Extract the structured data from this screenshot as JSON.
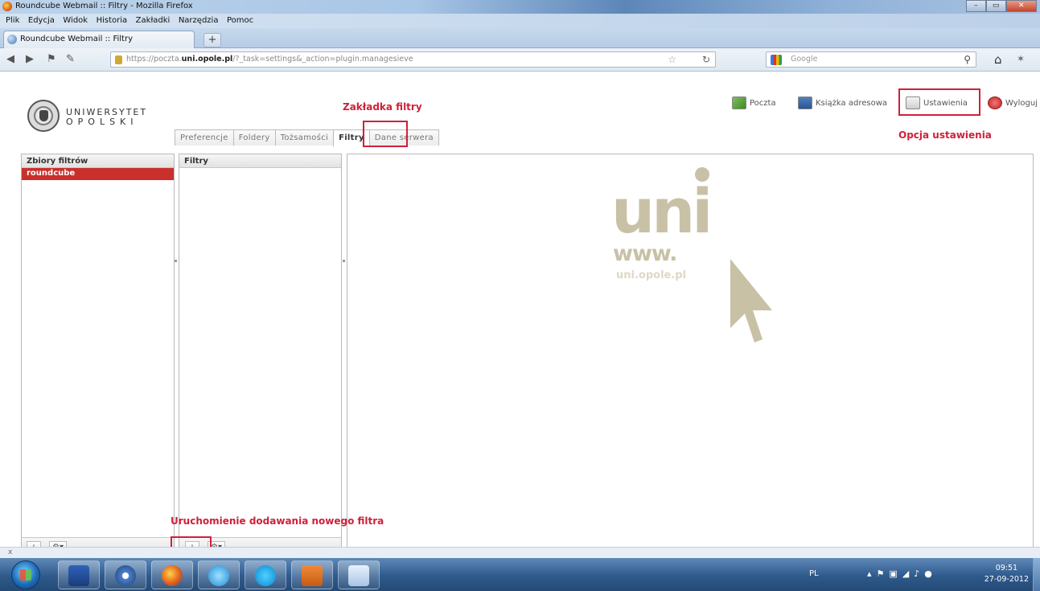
{
  "window": {
    "title": "Roundcube Webmail :: Filtry - Mozilla Firefox",
    "minimize": "–",
    "maximize": "▭",
    "close": "✕"
  },
  "menubar": [
    "Plik",
    "Edycja",
    "Widok",
    "Historia",
    "Zakładki",
    "Narzędzia",
    "Pomoc"
  ],
  "browser_tab": {
    "label": "Roundcube Webmail :: Filtry",
    "newtab": "+"
  },
  "navbar": {
    "url_prefix": "https://poczta.",
    "url_host": "uni.opole.pl",
    "url_path": "/?_task=settings&_action=plugin.managesieve",
    "search_engine": "Google"
  },
  "logo": {
    "line1": "UNIWERSYTET",
    "line2": "OPOLSKI"
  },
  "topmenu": {
    "mail": "Poczta",
    "addressbook": "Książka adresowa",
    "settings": "Ustawienia",
    "logout": "Wyloguj"
  },
  "tabs": [
    "Preferencje",
    "Foldery",
    "Tożsamości",
    "Filtry",
    "Dane serwera"
  ],
  "selected_tab": "Filtry",
  "filtersets": {
    "header": "Zbiory filtrów",
    "items": [
      "roundcube"
    ],
    "add": "+",
    "gear": "⚙▾"
  },
  "filters": {
    "header": "Filtry",
    "items": [],
    "add": "+",
    "gear": "⚙▾"
  },
  "watermark": {
    "text": "uni",
    "www": "www.",
    "url": "uni.opole.pl"
  },
  "annotations": {
    "tab": "Zakładka filtry",
    "settings": "Opcja ustawienia",
    "add_filter": "Uruchomienie dodawania nowego filtra"
  },
  "statusbar": {
    "text": "x"
  },
  "taskbar": {
    "lang": "PL",
    "time": "09:51",
    "date": "27-09-2012"
  },
  "colors": {
    "annotation": "#d0203a",
    "selected_row": "#c9302c",
    "watermark": "#c8c1a6"
  }
}
